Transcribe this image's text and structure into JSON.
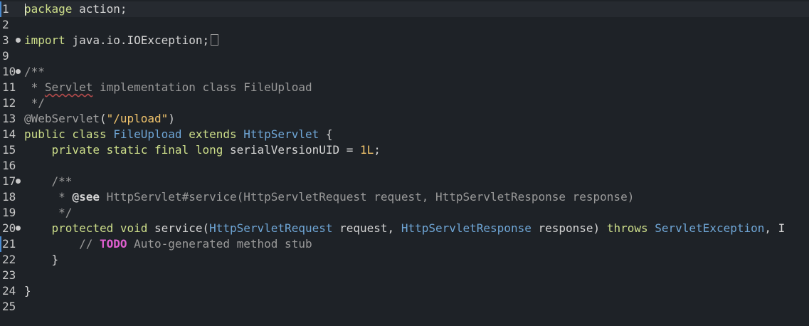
{
  "editor": {
    "lines": [
      {
        "num": "1",
        "tokens": [
          [
            "kw",
            "package"
          ],
          [
            "plain",
            " action;"
          ]
        ]
      },
      {
        "num": "2",
        "tokens": []
      },
      {
        "num": "3",
        "tokens": [
          [
            "kw",
            "import"
          ],
          [
            "plain",
            " java.io.IOException;"
          ]
        ]
      },
      {
        "num": "9",
        "tokens": []
      },
      {
        "num": "10",
        "tokens": [
          [
            "cmt",
            "/**"
          ]
        ]
      },
      {
        "num": "11",
        "tokens": [
          [
            "cmt",
            " * "
          ],
          [
            "cmt",
            "Servlet"
          ],
          [
            "cmt",
            " implementation class FileUpload"
          ]
        ]
      },
      {
        "num": "12",
        "tokens": [
          [
            "cmt",
            " */"
          ]
        ]
      },
      {
        "num": "13",
        "tokens": [
          [
            "ann",
            "@WebServlet"
          ],
          [
            "plain",
            "("
          ],
          [
            "str",
            "\"/upload\""
          ],
          [
            "plain",
            ")"
          ]
        ]
      },
      {
        "num": "14",
        "tokens": [
          [
            "kw",
            "public class "
          ],
          [
            "type",
            "FileUpload"
          ],
          [
            "kw",
            " extends "
          ],
          [
            "type",
            "HttpServlet"
          ],
          [
            "plain",
            " {"
          ]
        ]
      },
      {
        "num": "15",
        "tokens": [
          [
            "plain",
            "    "
          ],
          [
            "kw",
            "private static final long "
          ],
          [
            "plain",
            "serialVersionUID = "
          ],
          [
            "num",
            "1L"
          ],
          [
            "plain",
            ";"
          ]
        ]
      },
      {
        "num": "16",
        "tokens": []
      },
      {
        "num": "17",
        "tokens": [
          [
            "plain",
            "    "
          ],
          [
            "cmt",
            "/**"
          ]
        ]
      },
      {
        "num": "18",
        "tokens": [
          [
            "plain",
            "     "
          ],
          [
            "cmt",
            "* "
          ],
          [
            "cmt-tag",
            "@see"
          ],
          [
            "cmt",
            " HttpServlet#service(HttpServletRequest request, HttpServletResponse response)"
          ]
        ]
      },
      {
        "num": "19",
        "tokens": [
          [
            "plain",
            "     "
          ],
          [
            "cmt",
            "*/"
          ]
        ]
      },
      {
        "num": "20",
        "tokens": [
          [
            "plain",
            "    "
          ],
          [
            "kw",
            "protected void "
          ],
          [
            "plain",
            "service("
          ],
          [
            "type",
            "HttpServletRequest"
          ],
          [
            "plain",
            " request, "
          ],
          [
            "type",
            "HttpServletResponse"
          ],
          [
            "plain",
            " response) "
          ],
          [
            "kw",
            "throws "
          ],
          [
            "type",
            "ServletException"
          ],
          [
            "plain",
            ", I"
          ]
        ]
      },
      {
        "num": "21",
        "tokens": [
          [
            "plain",
            "        "
          ],
          [
            "cmt",
            "// "
          ],
          [
            "todo",
            "TODO"
          ],
          [
            "cmt",
            " Auto-generated method stub"
          ]
        ]
      },
      {
        "num": "22",
        "tokens": [
          [
            "plain",
            "    }"
          ]
        ]
      },
      {
        "num": "23",
        "tokens": []
      },
      {
        "num": "24",
        "tokens": [
          [
            "plain",
            "}"
          ]
        ]
      },
      {
        "num": "25",
        "tokens": []
      }
    ]
  }
}
